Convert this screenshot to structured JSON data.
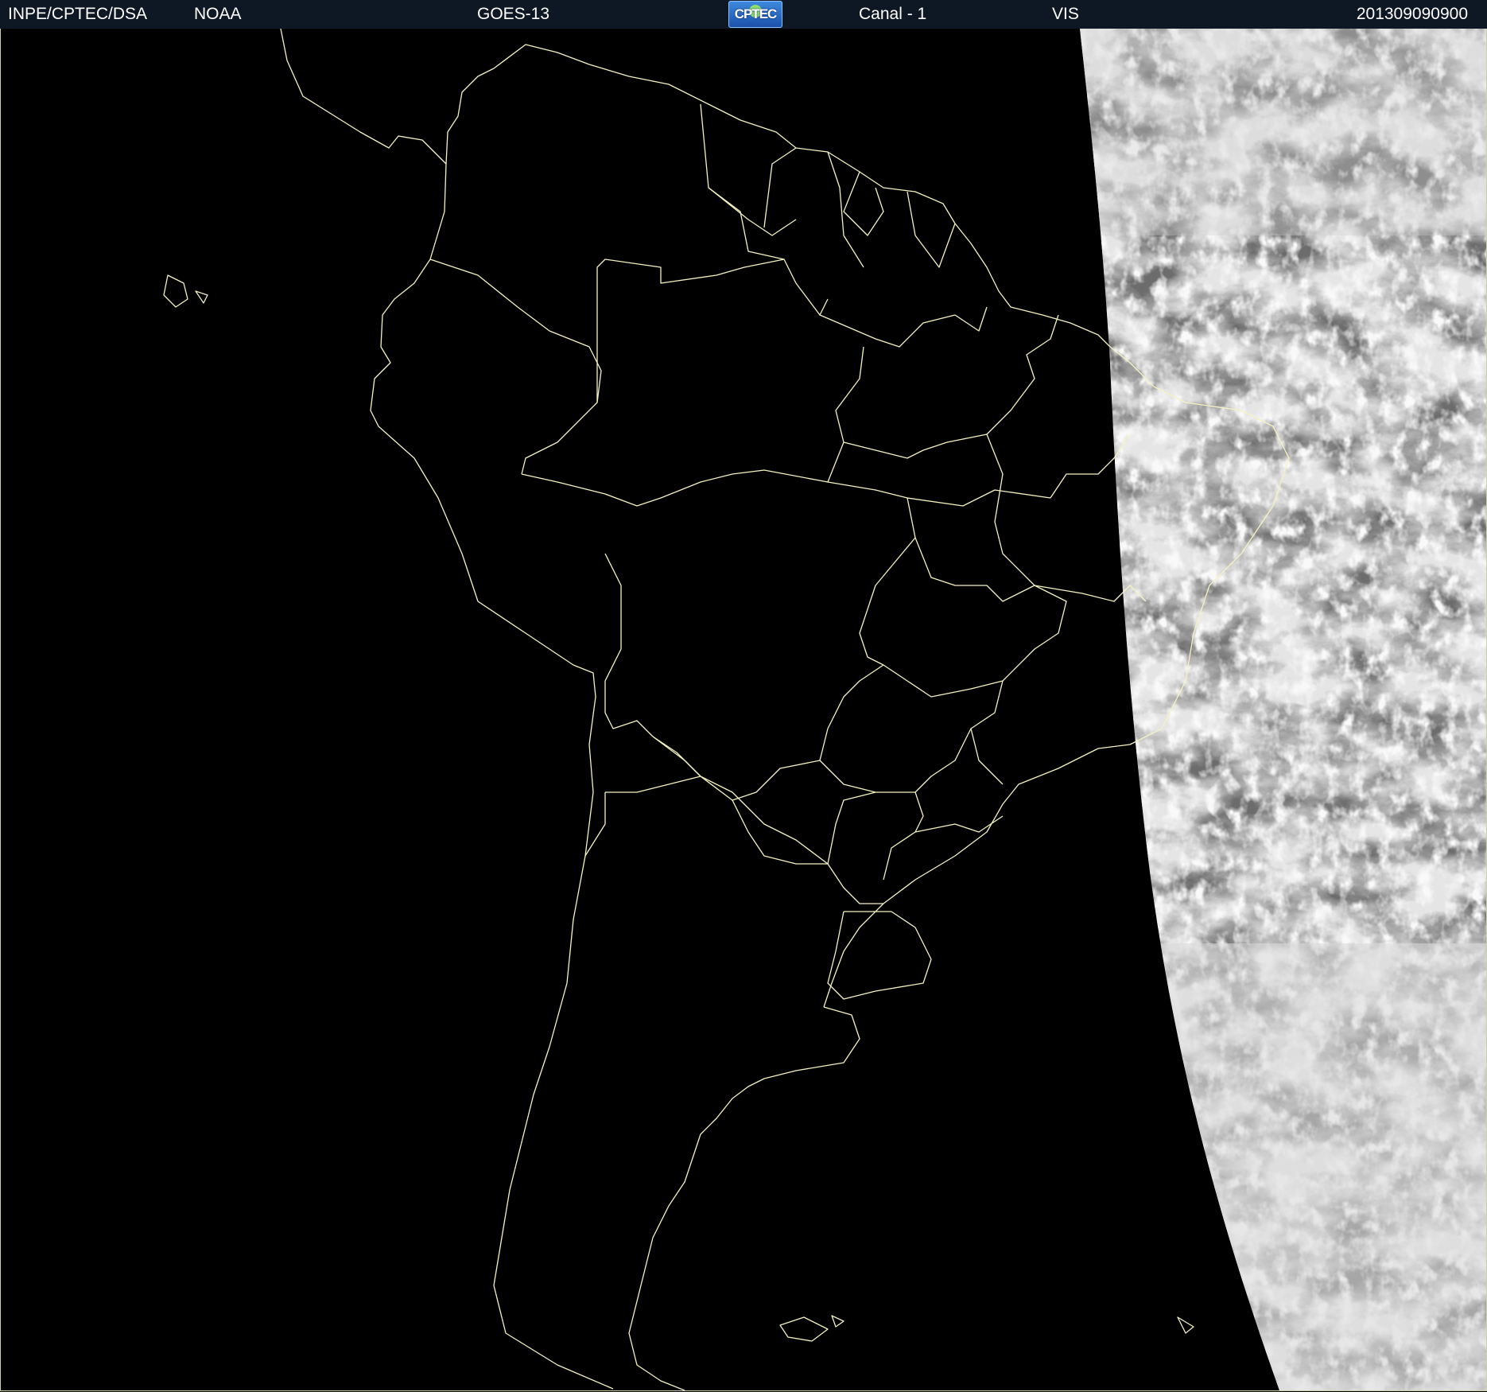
{
  "header": {
    "org": "INPE/CPTEC/DSA",
    "agency": "NOAA",
    "satellite": "GOES-13",
    "logo_text": "CPTEC",
    "channel": "Canal - 1",
    "band": "VIS",
    "timestamp": "201309090900"
  },
  "map": {
    "region": "South America",
    "imagery": "visible-channel satellite image",
    "boundary_color": "#f5f2c0",
    "cloud_color": "#d9d9d9",
    "space_color": "#000000"
  }
}
